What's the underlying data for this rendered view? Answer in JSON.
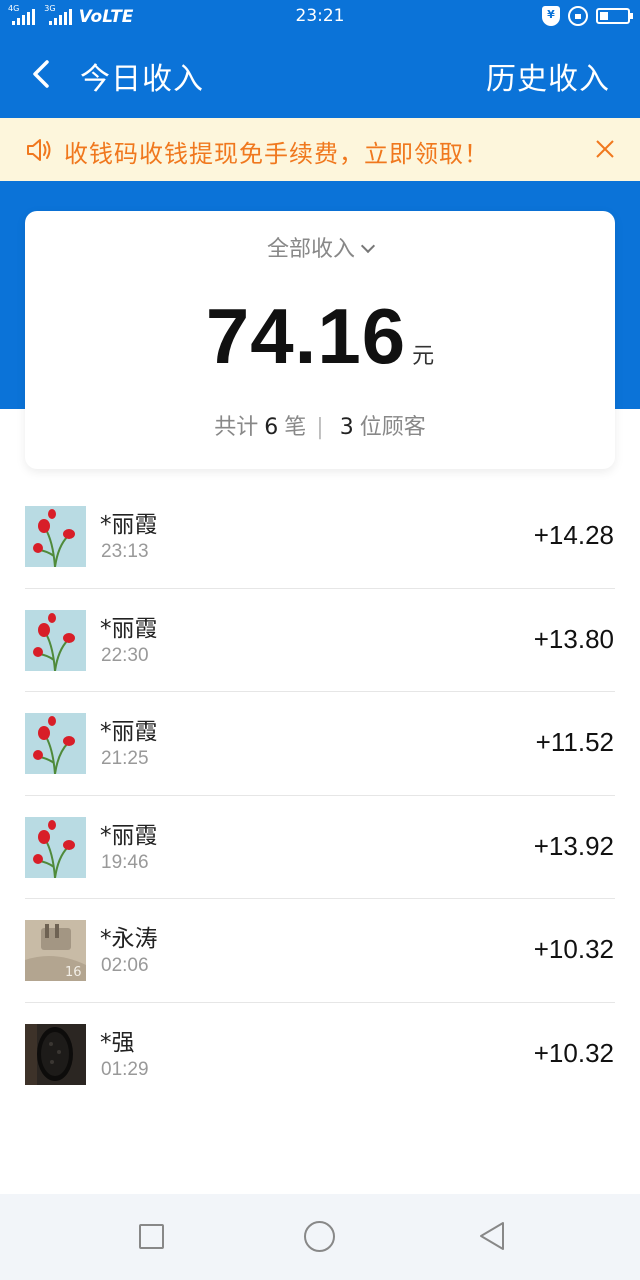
{
  "status_bar": {
    "net_tag_1": "4G",
    "net_tag_2": "3G",
    "volte": "VoLTE",
    "time": "23:21",
    "shield_glyph": "¥",
    "battery_level": 0.3
  },
  "header": {
    "back_icon": "chevron-left-icon",
    "title": "今日收入",
    "history_link": "历史收入"
  },
  "notice": {
    "icon": "speaker-icon",
    "text": "收钱码收钱提现免手续费，立即领取！",
    "close_icon": "close-icon"
  },
  "summary": {
    "filter_label": "全部收入",
    "amount": "74.16",
    "unit": "元",
    "stats_prefix": "共计",
    "count": "6",
    "count_unit": "笔",
    "separator": "|",
    "customers": "3",
    "customers_unit": "位顾客"
  },
  "transactions": [
    {
      "name": "*丽霞",
      "time": "23:13",
      "amount": "+14.28",
      "avatar": "tulip"
    },
    {
      "name": "*丽霞",
      "time": "22:30",
      "amount": "+13.80",
      "avatar": "tulip"
    },
    {
      "name": "*丽霞",
      "time": "21:25",
      "amount": "+11.52",
      "avatar": "tulip"
    },
    {
      "name": "*丽霞",
      "time": "19:46",
      "amount": "+13.92",
      "avatar": "tulip"
    },
    {
      "name": "*永涛",
      "time": "02:06",
      "amount": "+10.32",
      "avatar": "sand-photo"
    },
    {
      "name": "*强",
      "time": "01:29",
      "amount": "+10.32",
      "avatar": "dark-object"
    }
  ],
  "nav": {
    "recents_icon": "square-icon",
    "home_icon": "circle-icon",
    "back_icon": "triangle-back-icon"
  },
  "colors": {
    "primary": "#0b73d8",
    "notice_bg": "#fdf6dc",
    "notice_text": "#f0781e"
  }
}
